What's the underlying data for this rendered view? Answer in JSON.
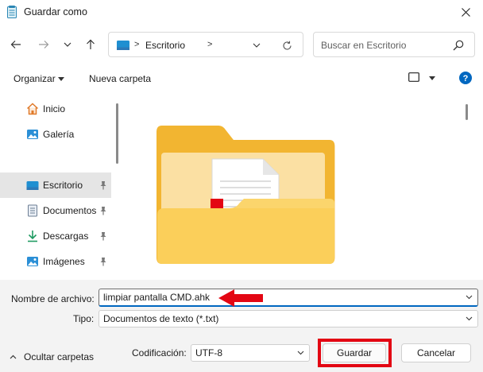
{
  "window": {
    "title": "Guardar como",
    "close_icon": "close-icon"
  },
  "navigation": {
    "back_icon": "arrow-left-icon",
    "forward_icon": "arrow-right-icon",
    "recent_icon": "chevron-down-icon",
    "up_icon": "arrow-up-icon",
    "address": {
      "location": "Escritorio",
      "separator": ">"
    },
    "search": {
      "placeholder": "Buscar en Escritorio"
    }
  },
  "toolbar": {
    "organize_label": "Organizar",
    "new_folder_label": "Nueva carpeta"
  },
  "sidebar": {
    "items": [
      {
        "label": "Inicio",
        "icon": "home-icon",
        "pinned": false,
        "selected": false
      },
      {
        "label": "Galería",
        "icon": "gallery-icon",
        "pinned": false,
        "selected": false
      },
      {
        "label": "Escritorio",
        "icon": "desktop-icon",
        "pinned": true,
        "selected": true
      },
      {
        "label": "Documentos",
        "icon": "documents-icon",
        "pinned": true,
        "selected": false
      },
      {
        "label": "Descargas",
        "icon": "download-icon",
        "pinned": true,
        "selected": false
      },
      {
        "label": "Imágenes",
        "icon": "pictures-icon",
        "pinned": true,
        "selected": false
      }
    ]
  },
  "content": {
    "items": [
      {
        "type": "folder",
        "icon": "folder-with-document-icon"
      }
    ]
  },
  "form": {
    "filename_label": "Nombre de archivo:",
    "filename_value": "limpiar pantalla CMD.ahk",
    "type_label": "Tipo:",
    "type_value": "Documentos de texto (*.txt)",
    "encoding_label": "Codificación:",
    "encoding_value": "UTF-8",
    "hide_folders_label": "Ocultar carpetas",
    "save_label": "Guardar",
    "cancel_label": "Cancelar"
  },
  "colors": {
    "accent": "#0067c0",
    "highlight": "#e30613",
    "folder": "#f8c640"
  }
}
